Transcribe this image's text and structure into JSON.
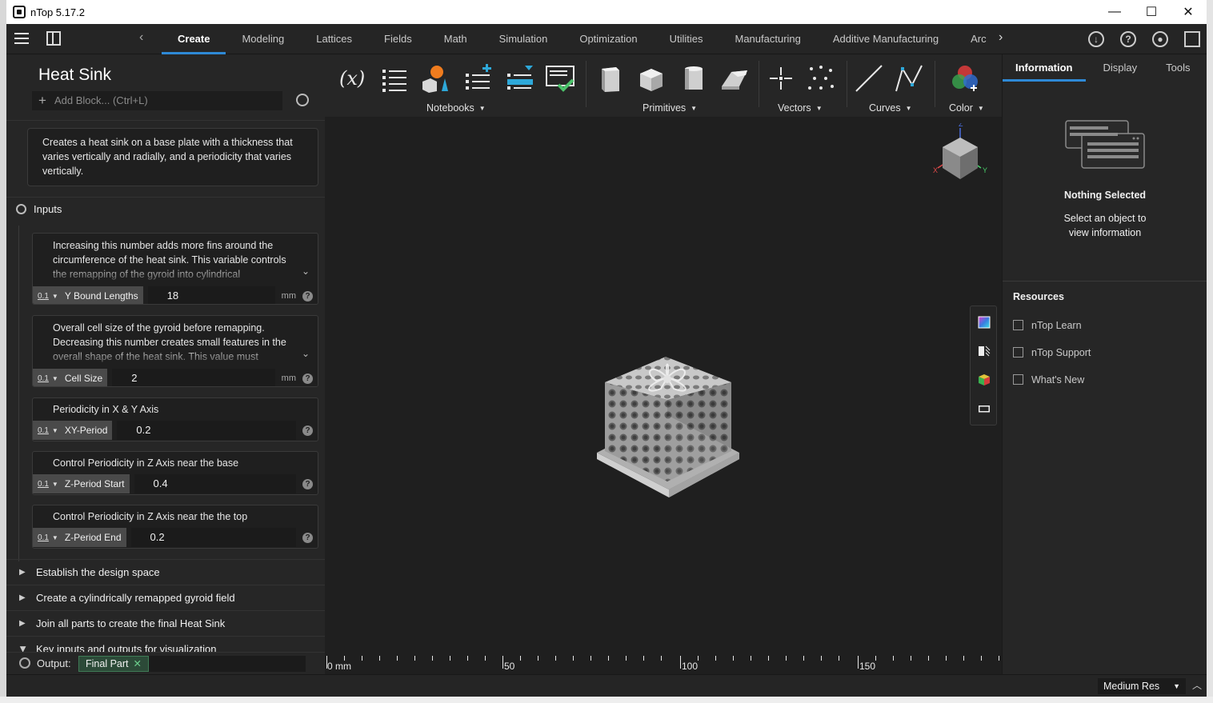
{
  "window": {
    "title": "nTop 5.17.2",
    "controls": [
      "—",
      "☐",
      "✕"
    ]
  },
  "menubar": {
    "tabs": [
      "Create",
      "Modeling",
      "Lattices",
      "Fields",
      "Math",
      "Simulation",
      "Optimization",
      "Utilities",
      "Manufacturing",
      "Additive Manufacturing",
      "Archite"
    ],
    "active_tab": "Create",
    "right_icons": [
      "download-icon",
      "help-icon",
      "account-icon",
      "panel-toggle-icon"
    ],
    "help_glyph": "?"
  },
  "ribbon": {
    "groups": [
      {
        "label": "Notebooks",
        "icons": [
          "variable-icon",
          "list-icon",
          "shapes-icon",
          "list-add-icon",
          "list-edit-icon",
          "checked-notebook-icon"
        ]
      },
      {
        "label": "Primitives",
        "icons": [
          "box-icon",
          "cube-icon",
          "cylinder-icon",
          "wedge-icon"
        ]
      },
      {
        "label": "Vectors",
        "icons": [
          "point-icon",
          "point-cloud-icon"
        ]
      },
      {
        "label": "Curves",
        "icons": [
          "line-icon",
          "polyline-icon"
        ]
      },
      {
        "label": "Color",
        "icons": [
          "color-icon"
        ]
      }
    ],
    "variable_glyph": "(x)",
    "caret": "▼"
  },
  "left_panel": {
    "notebook_title": "Heat Sink",
    "add_block_placeholder": "Add Block... (Ctrl+L)",
    "add_glyph": "+",
    "description": "Creates a heat sink on a base plate with a thickness that varies vertically and radially, and a periodicity that varies vertically.",
    "inputs_label": "Inputs",
    "inputs": [
      {
        "description": "Increasing this number adds more fins around the circumference of the heat sink. This variable controls the remapping of the gyroid into cylindrical",
        "type_num": "0.1",
        "name": "Y Bound Lengths",
        "value": "18",
        "unit": "mm",
        "expandable": true
      },
      {
        "description": "Overall cell size of the gyroid before remapping. Decreasing this number creates small features in the overall shape of the heat sink. This value must",
        "type_num": "0.1",
        "name": "Cell Size",
        "value": "2",
        "unit": "mm",
        "expandable": true
      },
      {
        "description": "Periodicity in X & Y Axis",
        "type_num": "0.1",
        "name": "XY-Period",
        "value": "0.2",
        "unit": "",
        "expandable": false
      },
      {
        "description": "Control Periodicity in Z Axis near the base",
        "type_num": "0.1",
        "name": "Z-Period Start",
        "value": "0.4",
        "unit": "",
        "expandable": false
      },
      {
        "description": "Control Periodicity in Z Axis near the the top",
        "type_num": "0.1",
        "name": "Z-Period End",
        "value": "0.2",
        "unit": "",
        "expandable": false
      }
    ],
    "help_glyph": "?",
    "dropdown_glyph": "▼",
    "expand_glyph": "⌄",
    "sections": [
      "Establish the design space",
      "Create a cylindrically remapped gyroid field",
      "Join all parts to create the final Heat Sink",
      "Key inputs and outputs for visualization"
    ],
    "section_glyph": "▶",
    "output_label": "Output:",
    "output_value": "Final Part",
    "output_remove": "✕"
  },
  "viewport": {
    "ruler_labels": [
      "0 mm",
      "50",
      "100",
      "150"
    ],
    "nav_axes": [
      "Z",
      "X",
      "Y"
    ],
    "side_tools": [
      "gradient-icon",
      "section-icon",
      "color-cube-icon",
      "measure-icon"
    ]
  },
  "right_panel": {
    "tabs": [
      "Information",
      "Display",
      "Tools"
    ],
    "active_tab": "Information",
    "nothing_selected": "Nothing Selected",
    "hint": "Select an object to view information",
    "resources_title": "Resources",
    "links": [
      "nTop Learn",
      "nTop Support",
      "What's New"
    ]
  },
  "statusbar": {
    "resolution": "Medium Res",
    "caret": "▼",
    "up": "︿"
  },
  "colors": {
    "accent": "#2e89d6",
    "background": "#1f1f1f",
    "panel": "#262626",
    "chip": "#3f7b56"
  }
}
